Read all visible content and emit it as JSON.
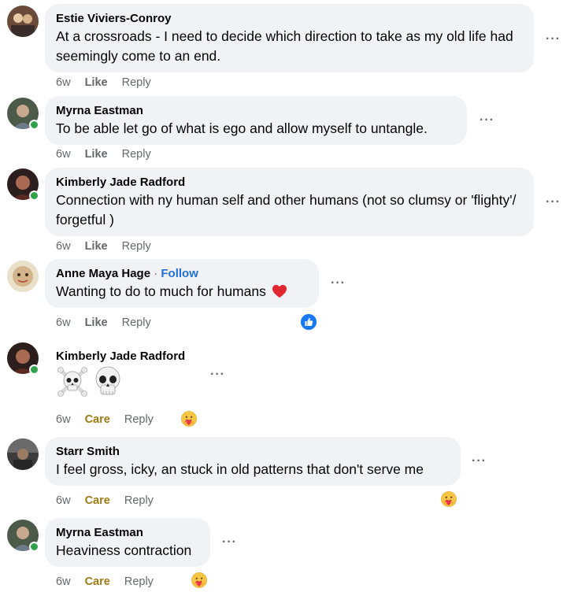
{
  "comments": [
    {
      "author": "Estie Viviers-Conroy",
      "text": "At a crossroads - I need to decide which direction to take as my old life had seemingly come to an end.",
      "time": "6w",
      "action": "Like",
      "reply": "Reply",
      "more": "···"
    },
    {
      "author": "Myrna Eastman",
      "text": "To be able let go of what is ego and allow myself to untangle.",
      "time": "6w",
      "action": "Like",
      "reply": "Reply",
      "more": "···"
    },
    {
      "author": "Kimberly Jade Radford",
      "text": "Connection with ny human self and other humans (not so clumsy or 'flighty'/ forgetful )",
      "time": "6w",
      "action": "Like",
      "reply": "Reply",
      "more": "···"
    },
    {
      "author": "Anne Maya Hage",
      "separator": "·",
      "follow": "Follow",
      "text": "Wanting to do to much for humans",
      "time": "6w",
      "action": "Like",
      "reply": "Reply",
      "more": "···",
      "reaction_icon": "like-icon"
    },
    {
      "author": "Kimberly Jade Radford",
      "text": "☠️💀",
      "time": "6w",
      "action": "Care",
      "reply": "Reply",
      "more": "···",
      "reaction_icon": "care-icon"
    },
    {
      "author": "Starr Smith",
      "text": "I feel gross, icky, an stuck in old patterns that don't serve me",
      "time": "6w",
      "action": "Care",
      "reply": "Reply",
      "more": "···",
      "reaction_icon": "care-icon"
    },
    {
      "author": "Myrna Eastman",
      "text": "Heaviness contraction",
      "time": "6w",
      "action": "Care",
      "reply": "Reply",
      "more": "···",
      "reaction_icon": "care-icon"
    }
  ],
  "colors": {
    "bubble": "#f0f2f5",
    "follow": "#216fdb",
    "care": "#a17915",
    "online": "#31a24c",
    "meta": "#65676b"
  }
}
